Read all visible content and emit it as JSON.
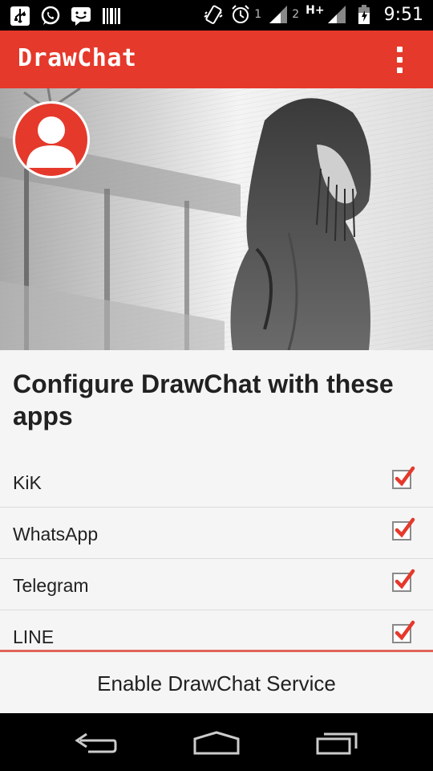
{
  "status_bar": {
    "icons": [
      "usb-icon",
      "whatsapp-icon",
      "messaging-icon",
      "barcode-icon",
      "vibrate-icon",
      "alarm-icon",
      "signal-icon",
      "signal-icon",
      "battery-icon"
    ],
    "sim1_label": "1",
    "sim2_label": "2",
    "network_type": "H+",
    "time": "9:51"
  },
  "app_bar": {
    "title": "DrawChat",
    "menu_icon": "overflow-menu-icon"
  },
  "colors": {
    "accent": "#e5392b",
    "checkmark": "#e5392b",
    "background": "#f5f5f5"
  },
  "main": {
    "heading": "Configure DrawChat with these apps",
    "apps": [
      {
        "label": "KiK",
        "checked": true
      },
      {
        "label": "WhatsApp",
        "checked": true
      },
      {
        "label": "Telegram",
        "checked": true
      },
      {
        "label": "LINE",
        "checked": true
      }
    ]
  },
  "footer": {
    "enable_label": "Enable DrawChat Service"
  },
  "nav_bar": {
    "icons": [
      "back-icon",
      "home-icon",
      "recents-icon"
    ]
  }
}
